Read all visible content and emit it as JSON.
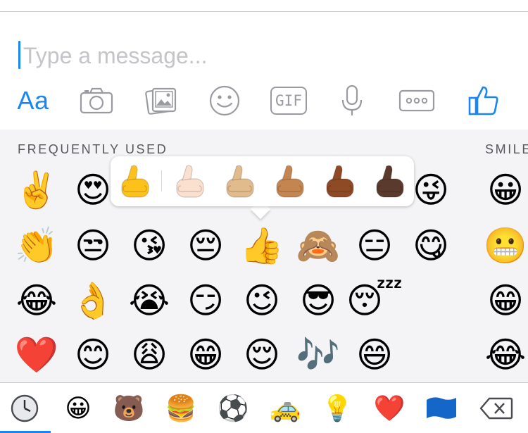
{
  "composer": {
    "placeholder": "Type a message...",
    "text_format_label": "Aa",
    "gif_label": "GIF"
  },
  "colors": {
    "accent": "#1a86f2",
    "icon_gray": "#9a9ba0",
    "panel_bg": "#f4f4f6"
  },
  "panel": {
    "frequently_used_title": "FREQUENTLY USED",
    "smileys_title": "SMILE",
    "grid": [
      [
        "✌️",
        "😍",
        "",
        "",
        "",
        "",
        "",
        "😜"
      ],
      [
        "👏",
        "😒",
        "😘",
        "😔",
        "👍",
        "🙈",
        "😑",
        "😋"
      ],
      [
        "😂",
        "👌",
        "😭",
        "😏",
        "😉",
        "😎",
        "😴",
        ""
      ],
      [
        "❤️",
        "😊",
        "😩",
        "😁",
        "😌",
        "🎶",
        "😄",
        ""
      ]
    ],
    "smileys_column": [
      "😀",
      "😬",
      "😁",
      "😂"
    ]
  },
  "skin_tone_popup": {
    "tones": [
      "#fcc21b",
      "#fbe0d0",
      "#e2bb8c",
      "#c48551",
      "#8d4a25",
      "#5b3a2e"
    ]
  },
  "categories": [
    {
      "name": "recent",
      "glyph": ""
    },
    {
      "name": "smileys",
      "glyph": "😀"
    },
    {
      "name": "animals",
      "glyph": "🐻"
    },
    {
      "name": "food",
      "glyph": "🍔"
    },
    {
      "name": "activity",
      "glyph": "⚽"
    },
    {
      "name": "travel",
      "glyph": "🚕"
    },
    {
      "name": "objects",
      "glyph": "💡"
    },
    {
      "name": "symbols",
      "glyph": "❤️"
    },
    {
      "name": "flags",
      "glyph": ""
    },
    {
      "name": "delete",
      "glyph": ""
    }
  ]
}
